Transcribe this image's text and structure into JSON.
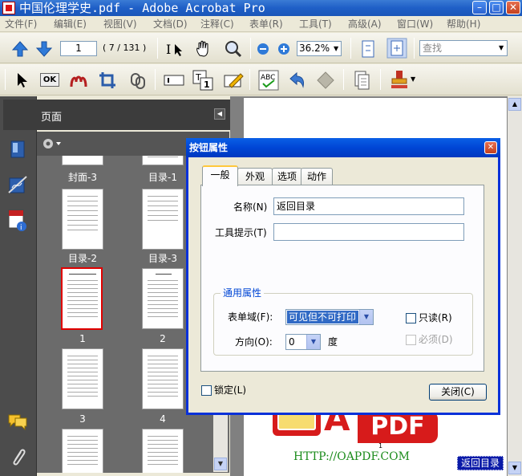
{
  "window": {
    "title": "中国伦理学史.pdf - Adobe Acrobat Pro"
  },
  "menu": [
    "文件(F)",
    "编辑(E)",
    "视图(V)",
    "文档(D)",
    "注释(C)",
    "表单(R)",
    "工具(T)",
    "高级(A)",
    "窗口(W)",
    "帮助(H)"
  ],
  "toolbar": {
    "page_number": "1",
    "page_count": "( 7 / 131 )",
    "zoom": "36.2%",
    "find_placeholder": "查找"
  },
  "tool2": {
    "ok_label": "OK"
  },
  "panel": {
    "title": "页面",
    "thumbnails": [
      {
        "label": "封面-3"
      },
      {
        "label": "目录-1"
      },
      {
        "label": "目录-2"
      },
      {
        "label": "目录-3"
      },
      {
        "label": "1"
      },
      {
        "label": "2"
      },
      {
        "label": "3"
      },
      {
        "label": "4"
      }
    ]
  },
  "document": {
    "return_button": "返回目录",
    "page_mark": "1"
  },
  "watermark": {
    "letter": "A",
    "pdf": "PDF",
    "url": "HTTP://OAPDF.COM"
  },
  "dialog": {
    "title": "按钮属性",
    "close_glyph": "✕",
    "tabs": [
      "一般",
      "外观",
      "选项",
      "动作"
    ],
    "name_label": "名称(N)",
    "name_value": "返回目录",
    "tooltip_label": "工具提示(T)",
    "tooltip_value": "",
    "group_title": "通用属性",
    "form_field_label": "表单域(F):",
    "form_field_value": "可见但不可打印",
    "orientation_label": "方向(O):",
    "orientation_value": "0",
    "degree_label": "度",
    "readonly_label": "只读(R)",
    "required_label": "必须(D)",
    "lock_label": "锁定(L)",
    "close_button": "关闭(C)"
  }
}
